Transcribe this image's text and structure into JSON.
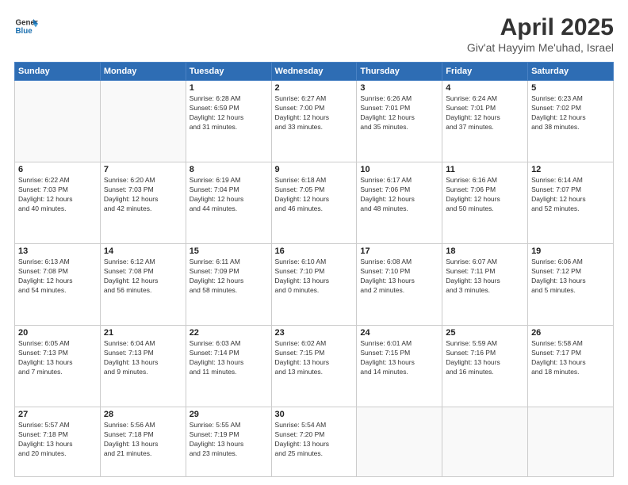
{
  "header": {
    "logo_line1": "General",
    "logo_line2": "Blue",
    "title": "April 2025",
    "subtitle": "Giv'at Hayyim Me'uhad, Israel"
  },
  "days_of_week": [
    "Sunday",
    "Monday",
    "Tuesday",
    "Wednesday",
    "Thursday",
    "Friday",
    "Saturday"
  ],
  "weeks": [
    [
      {
        "day": "",
        "info": ""
      },
      {
        "day": "",
        "info": ""
      },
      {
        "day": "1",
        "info": "Sunrise: 6:28 AM\nSunset: 6:59 PM\nDaylight: 12 hours\nand 31 minutes."
      },
      {
        "day": "2",
        "info": "Sunrise: 6:27 AM\nSunset: 7:00 PM\nDaylight: 12 hours\nand 33 minutes."
      },
      {
        "day": "3",
        "info": "Sunrise: 6:26 AM\nSunset: 7:01 PM\nDaylight: 12 hours\nand 35 minutes."
      },
      {
        "day": "4",
        "info": "Sunrise: 6:24 AM\nSunset: 7:01 PM\nDaylight: 12 hours\nand 37 minutes."
      },
      {
        "day": "5",
        "info": "Sunrise: 6:23 AM\nSunset: 7:02 PM\nDaylight: 12 hours\nand 38 minutes."
      }
    ],
    [
      {
        "day": "6",
        "info": "Sunrise: 6:22 AM\nSunset: 7:03 PM\nDaylight: 12 hours\nand 40 minutes."
      },
      {
        "day": "7",
        "info": "Sunrise: 6:20 AM\nSunset: 7:03 PM\nDaylight: 12 hours\nand 42 minutes."
      },
      {
        "day": "8",
        "info": "Sunrise: 6:19 AM\nSunset: 7:04 PM\nDaylight: 12 hours\nand 44 minutes."
      },
      {
        "day": "9",
        "info": "Sunrise: 6:18 AM\nSunset: 7:05 PM\nDaylight: 12 hours\nand 46 minutes."
      },
      {
        "day": "10",
        "info": "Sunrise: 6:17 AM\nSunset: 7:06 PM\nDaylight: 12 hours\nand 48 minutes."
      },
      {
        "day": "11",
        "info": "Sunrise: 6:16 AM\nSunset: 7:06 PM\nDaylight: 12 hours\nand 50 minutes."
      },
      {
        "day": "12",
        "info": "Sunrise: 6:14 AM\nSunset: 7:07 PM\nDaylight: 12 hours\nand 52 minutes."
      }
    ],
    [
      {
        "day": "13",
        "info": "Sunrise: 6:13 AM\nSunset: 7:08 PM\nDaylight: 12 hours\nand 54 minutes."
      },
      {
        "day": "14",
        "info": "Sunrise: 6:12 AM\nSunset: 7:08 PM\nDaylight: 12 hours\nand 56 minutes."
      },
      {
        "day": "15",
        "info": "Sunrise: 6:11 AM\nSunset: 7:09 PM\nDaylight: 12 hours\nand 58 minutes."
      },
      {
        "day": "16",
        "info": "Sunrise: 6:10 AM\nSunset: 7:10 PM\nDaylight: 13 hours\nand 0 minutes."
      },
      {
        "day": "17",
        "info": "Sunrise: 6:08 AM\nSunset: 7:10 PM\nDaylight: 13 hours\nand 2 minutes."
      },
      {
        "day": "18",
        "info": "Sunrise: 6:07 AM\nSunset: 7:11 PM\nDaylight: 13 hours\nand 3 minutes."
      },
      {
        "day": "19",
        "info": "Sunrise: 6:06 AM\nSunset: 7:12 PM\nDaylight: 13 hours\nand 5 minutes."
      }
    ],
    [
      {
        "day": "20",
        "info": "Sunrise: 6:05 AM\nSunset: 7:13 PM\nDaylight: 13 hours\nand 7 minutes."
      },
      {
        "day": "21",
        "info": "Sunrise: 6:04 AM\nSunset: 7:13 PM\nDaylight: 13 hours\nand 9 minutes."
      },
      {
        "day": "22",
        "info": "Sunrise: 6:03 AM\nSunset: 7:14 PM\nDaylight: 13 hours\nand 11 minutes."
      },
      {
        "day": "23",
        "info": "Sunrise: 6:02 AM\nSunset: 7:15 PM\nDaylight: 13 hours\nand 13 minutes."
      },
      {
        "day": "24",
        "info": "Sunrise: 6:01 AM\nSunset: 7:15 PM\nDaylight: 13 hours\nand 14 minutes."
      },
      {
        "day": "25",
        "info": "Sunrise: 5:59 AM\nSunset: 7:16 PM\nDaylight: 13 hours\nand 16 minutes."
      },
      {
        "day": "26",
        "info": "Sunrise: 5:58 AM\nSunset: 7:17 PM\nDaylight: 13 hours\nand 18 minutes."
      }
    ],
    [
      {
        "day": "27",
        "info": "Sunrise: 5:57 AM\nSunset: 7:18 PM\nDaylight: 13 hours\nand 20 minutes."
      },
      {
        "day": "28",
        "info": "Sunrise: 5:56 AM\nSunset: 7:18 PM\nDaylight: 13 hours\nand 21 minutes."
      },
      {
        "day": "29",
        "info": "Sunrise: 5:55 AM\nSunset: 7:19 PM\nDaylight: 13 hours\nand 23 minutes."
      },
      {
        "day": "30",
        "info": "Sunrise: 5:54 AM\nSunset: 7:20 PM\nDaylight: 13 hours\nand 25 minutes."
      },
      {
        "day": "",
        "info": ""
      },
      {
        "day": "",
        "info": ""
      },
      {
        "day": "",
        "info": ""
      }
    ]
  ]
}
